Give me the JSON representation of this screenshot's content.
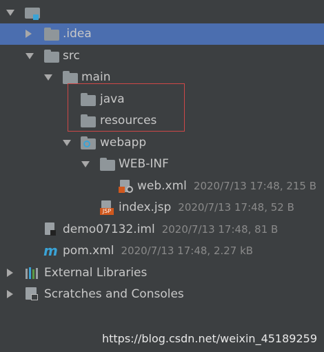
{
  "tree": {
    "root_label_hidden": "",
    "items": [
      {
        "label": ".idea",
        "meta": ""
      },
      {
        "label": "src",
        "meta": ""
      },
      {
        "label": "main",
        "meta": ""
      },
      {
        "label": "java",
        "meta": ""
      },
      {
        "label": "resources",
        "meta": ""
      },
      {
        "label": "webapp",
        "meta": ""
      },
      {
        "label": "WEB-INF",
        "meta": ""
      },
      {
        "label": "web.xml",
        "meta": "2020/7/13 17:48, 215 B"
      },
      {
        "label": "index.jsp",
        "meta": "2020/7/13 17:48, 52 B"
      },
      {
        "label": "demo07132.iml",
        "meta": "2020/7/13 17:48, 81 B"
      },
      {
        "label": "pom.xml",
        "meta": "2020/7/13 17:48, 2.27 kB"
      },
      {
        "label": "External Libraries",
        "meta": ""
      },
      {
        "label": "Scratches and Consoles",
        "meta": ""
      }
    ]
  },
  "watermark": "https://blog.csdn.net/weixin_45189259",
  "colors": {
    "background": "#3c3f41",
    "selection": "#4b6eaf",
    "highlight_box": "#d04848"
  }
}
